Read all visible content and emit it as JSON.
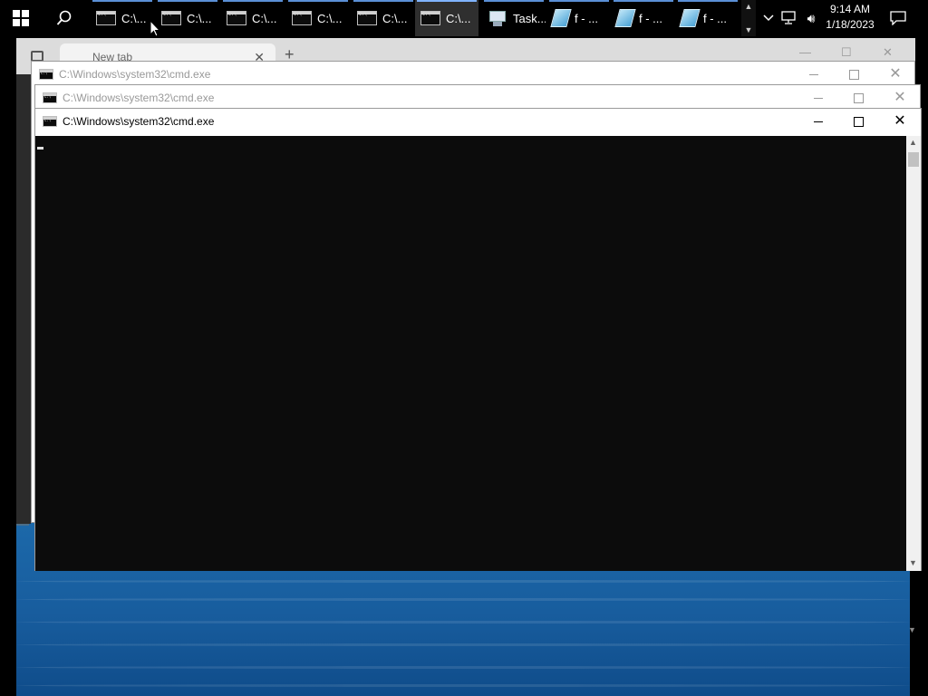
{
  "taskbar": {
    "apps": [
      {
        "label": "C:\\...",
        "icon": "cmd-icon",
        "active": false
      },
      {
        "label": "C:\\...",
        "icon": "cmd-icon",
        "active": false
      },
      {
        "label": "C:\\...",
        "icon": "cmd-icon",
        "active": false
      },
      {
        "label": "C:\\...",
        "icon": "cmd-icon",
        "active": false
      },
      {
        "label": "C:\\...",
        "icon": "cmd-icon",
        "active": false
      },
      {
        "label": "C:\\...",
        "icon": "cmd-icon",
        "active": true
      },
      {
        "label": "Task...",
        "icon": "task-manager-icon",
        "active": false
      },
      {
        "label": "f - ...",
        "icon": "notepad-icon",
        "active": false
      },
      {
        "label": "f - ...",
        "icon": "notepad-icon",
        "active": false
      },
      {
        "label": "f - ...",
        "icon": "notepad-icon",
        "active": false
      }
    ],
    "clock": {
      "time": "9:14 AM",
      "date": "1/18/2023"
    }
  },
  "browser": {
    "tab_title": "New tab"
  },
  "cmd_windows": [
    {
      "title": "C:\\Windows\\system32\\cmd.exe"
    },
    {
      "title": "C:\\Windows\\system32\\cmd.exe"
    },
    {
      "title": "C:\\Windows\\system32\\cmd.exe"
    }
  ],
  "colors": {
    "taskbar_bg": "#000000",
    "console_bg": "#0c0c0c",
    "accent": "#5a8fd6"
  }
}
